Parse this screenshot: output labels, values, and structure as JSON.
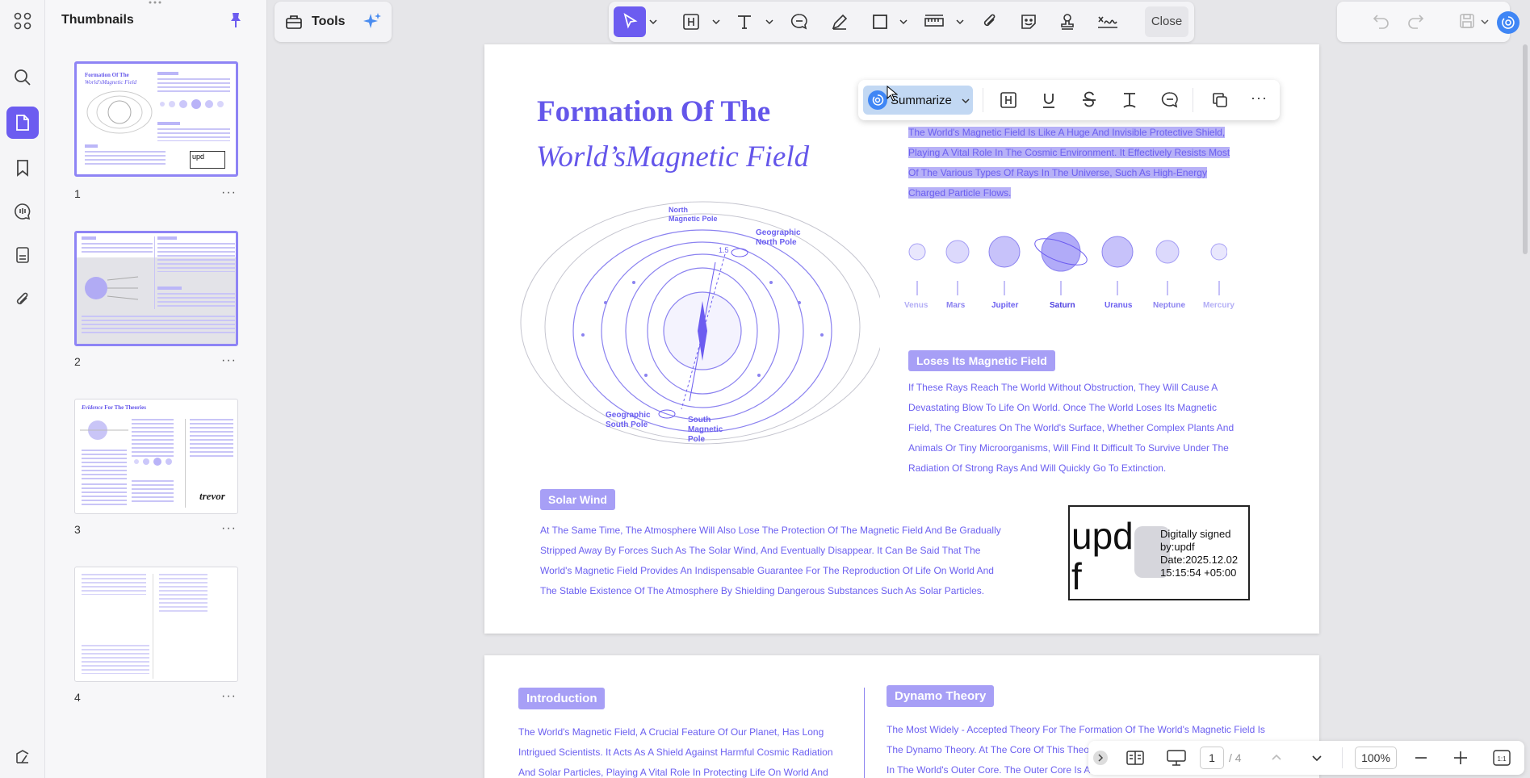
{
  "sidebar": {
    "title": "Thumbnails",
    "pages": [
      "1",
      "2",
      "3",
      "4"
    ],
    "thumb3_heading_italic": "Evidence",
    "thumb3_heading_rest": " For The Theories",
    "thumb3_signature": "trevor",
    "thumb1_title1": "Formation Of The",
    "thumb1_title2": "World'sMagnetic Field",
    "thumb_upd": "upd"
  },
  "toolbar": {
    "tools_label": "Tools",
    "close_label": "Close"
  },
  "float_toolbar": {
    "summarize_label": "Summarize"
  },
  "page1": {
    "title_line1": "Formation Of The",
    "title_line2": "World’sMagnetic Field",
    "selected_text_lines": [
      "The World's Magnetic Field Is Like A Huge And Invisible Protective Shield,",
      "Playing A Vital Role In The Cosmic Environment. It Effectively Resists Most",
      "Of The Various Types Of Rays In The Universe, Such As High-Energy",
      "Charged Particle Flows."
    ],
    "planets": [
      "Venus",
      "Mars",
      "Jupiter",
      "Saturn",
      "Uranus",
      "Neptune",
      "Mercury"
    ],
    "diagram_labels": {
      "north_magnetic_pole": "North\nMagnetic Pole",
      "geographic_north_pole": "Geographic\nNorth Pole",
      "angle": "1.5",
      "geographic_south_pole": "Geographic\nSouth Pole",
      "south_magnetic_pole": "South\nMagnetic\nPole"
    },
    "loses_heading": "Loses Its Magnetic Field",
    "loses_lines": [
      "If These Rays Reach The World Without Obstruction, They Will Cause A",
      "Devastating Blow To Life On World. Once The World Loses Its Magnetic",
      "Field, The Creatures On The World's Surface, Whether Complex Plants And",
      "Animals Or Tiny Microorganisms, Will Find It Difficult To Survive Under The",
      "Radiation Of Strong Rays And Will Quickly Go To Extinction."
    ],
    "solar_heading": "Solar Wind",
    "solar_lines": [
      "At The Same Time, The Atmosphere Will Also Lose The Protection Of The Magnetic Field And Be Gradually",
      "Stripped Away By Forces Such As The Solar Wind, And Eventually Disappear. It Can Be Said That The",
      "World's Magnetic Field Provides An Indispensable Guarantee For The Reproduction Of Life On World And",
      "The Stable Existence Of The Atmosphere By Shielding Dangerous Substances Such As Solar Particles."
    ],
    "signature": {
      "logo1": "upd",
      "logo2": "f",
      "line1": "Digitally signed",
      "line2": "by:updf",
      "line3": "Date:2025.12.02",
      "line4": "15:15:54 +05:00"
    }
  },
  "page2": {
    "intro_heading": "Introduction",
    "intro_lines": [
      "The World's Magnetic Field, A Crucial Feature Of Our Planet, Has Long",
      "Intrigued Scientists. It Acts As A Shield Against Harmful Cosmic Radiation",
      "And Solar Particles, Playing A Vital Role In Protecting Life On World And"
    ],
    "dynamo_heading": "Dynamo Theory",
    "dynamo_lines": [
      "The Most Widely - Accepted Theory For The Formation Of The World's Magnetic Field Is",
      "The Dynamo Theory. At The Core Of This Theory",
      "In The World's Outer Core. The Outer Core Is A"
    ]
  },
  "bottombar": {
    "current_page": "1",
    "total_pages": "/ 4",
    "zoom": "100%"
  },
  "colors": {
    "accent": "#6c5cf0",
    "text_purple": "#6b5ff0",
    "highlight": "#b7b1f7"
  }
}
